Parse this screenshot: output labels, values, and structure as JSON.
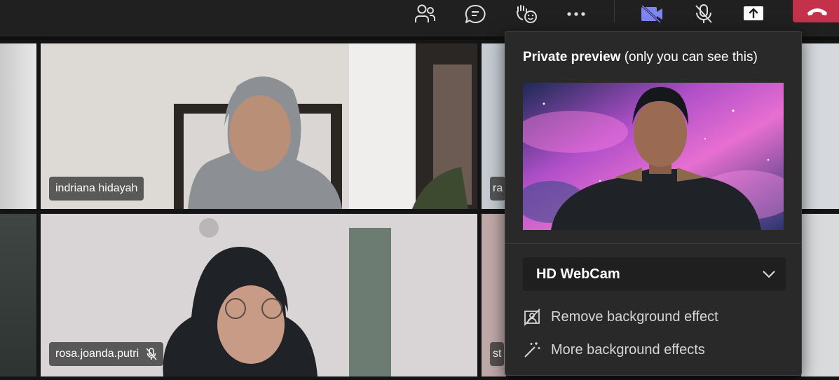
{
  "toolbar": {
    "items": [
      {
        "name": "people-icon"
      },
      {
        "name": "chat-icon"
      },
      {
        "name": "reactions-icon"
      },
      {
        "name": "more-options-icon"
      },
      {
        "name": "camera-off-icon"
      },
      {
        "name": "mic-off-icon"
      },
      {
        "name": "share-screen-icon"
      },
      {
        "name": "hang-up-icon"
      }
    ],
    "leave_color": "#c4314b",
    "camera_icon_color": "#7f85f5"
  },
  "participants": [
    {
      "name": "indriana hidayah",
      "muted": false
    },
    {
      "name": "ra",
      "muted": false
    },
    {
      "name": "rosa.joanda.putri",
      "muted": true
    },
    {
      "name": "st",
      "muted": false
    }
  ],
  "preview_flyout": {
    "title_bold": "Private preview",
    "title_rest": " (only you can see this)",
    "camera_select": {
      "value": "HD WebCam"
    },
    "options": [
      {
        "label": "Remove background effect",
        "icon": "remove-background-icon"
      },
      {
        "label": "More background effects",
        "icon": "magic-wand-icon"
      }
    ]
  }
}
